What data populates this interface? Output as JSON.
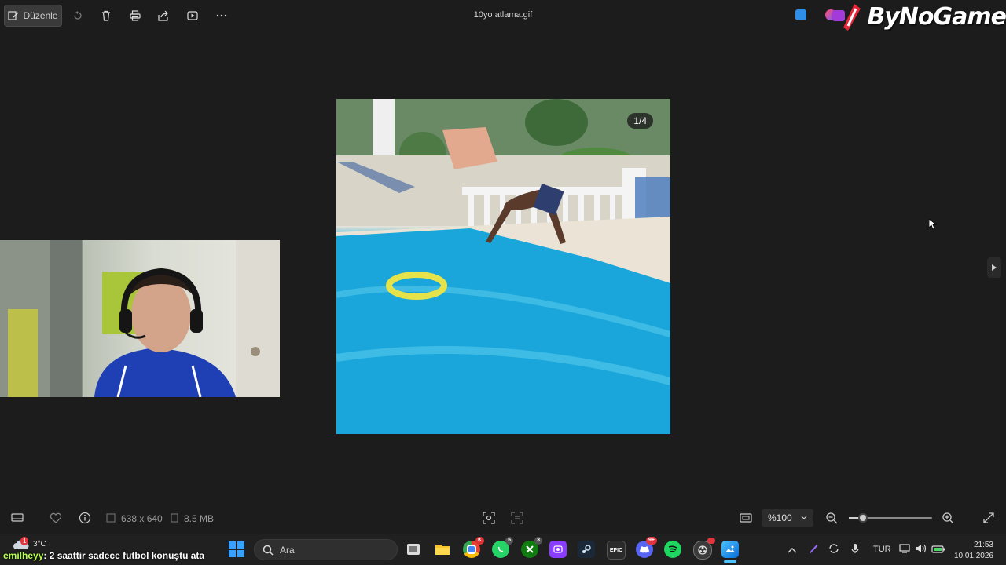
{
  "toolbar": {
    "edit_label": "Düzenle",
    "icons": [
      "edit-icon",
      "rotate-icon",
      "delete-icon",
      "print-icon",
      "share-icon",
      "slideshow-icon",
      "more-icon"
    ],
    "file_title": "10yo atlama.gif"
  },
  "overlay": {
    "logo_text": "ByNoGame"
  },
  "viewer": {
    "frame_counter": "1/4"
  },
  "infobar": {
    "dimensions": "638 x 640",
    "file_size": "8.5 MB",
    "zoom_value": "%100",
    "zoom_level": 0.17
  },
  "taskbar": {
    "weather_temp": "3°C",
    "weather_badge": "1",
    "search_placeholder": "Ara",
    "chat_user": "emilheyy",
    "chat_message": ": 2 saattir sadece futbol konuştu ata",
    "apps": [
      {
        "name": "windows-start",
        "badge": ""
      },
      {
        "name": "task-view",
        "badge": ""
      },
      {
        "name": "file-explorer",
        "badge": ""
      },
      {
        "name": "chrome",
        "badge": "K"
      },
      {
        "name": "whatsapp",
        "badge": "5"
      },
      {
        "name": "xbox",
        "badge": "3"
      },
      {
        "name": "app-purple",
        "badge": ""
      },
      {
        "name": "steam",
        "badge": ""
      },
      {
        "name": "epic-games",
        "badge": ""
      },
      {
        "name": "discord",
        "badge": "9+"
      },
      {
        "name": "spotify",
        "badge": ""
      },
      {
        "name": "obs",
        "badge": ""
      },
      {
        "name": "photos",
        "badge": ""
      }
    ],
    "epic_label": "EPIC",
    "language": "TUR",
    "time": "21:53",
    "date": "10.01.2026"
  },
  "colors": {
    "background": "#1c1c1c",
    "taskbar": "#202020",
    "accent": "#0078d4",
    "pool_blue": "#1aa6da",
    "chat_user": "#b6ff4a"
  }
}
